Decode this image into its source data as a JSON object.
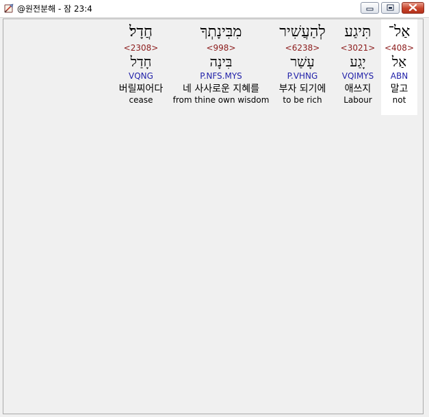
{
  "window": {
    "title": "@원전분해 - 잠 23:4",
    "app_icon": "scroll-feather-icon",
    "controls": [
      "minimize-icon",
      "maximize-icon",
      "close-icon"
    ]
  },
  "colors": {
    "strong_number": "#8b1a1a",
    "parsing": "#1f1fa8",
    "selected_background": "#ffffff",
    "pane_background": "#f0f0f0"
  },
  "words": [
    {
      "hebrew": "אַל־",
      "strong": "<408>",
      "lemma": "אַל",
      "parse": "ABN",
      "korean": "말고",
      "english": "not",
      "selected": true
    },
    {
      "hebrew": "תִּיגַע",
      "strong": "<3021>",
      "lemma": "יָגַע",
      "parse": "VQIMYS",
      "korean": "애쓰지",
      "english": "Labour",
      "selected": false
    },
    {
      "hebrew": "לְהַעֲשִׁיר",
      "strong": "<6238>",
      "lemma": "עָשַׁר",
      "parse": "P.VHNG",
      "korean": "부자 되기에",
      "english": "to be rich",
      "selected": false
    },
    {
      "hebrew": "מִבִּינָתְךָ",
      "strong": "<998>",
      "lemma": "בִּינָה",
      "parse": "P.NFS.MYS",
      "korean": "네 사사로운 지혜를",
      "english": "from thine own wisdom",
      "selected": false
    },
    {
      "hebrew": "חֲדָל׃",
      "strong": "<2308>",
      "lemma": "חָדַל",
      "parse": "VQNG",
      "korean": "버릴찌어다",
      "english": "cease",
      "selected": false
    }
  ]
}
